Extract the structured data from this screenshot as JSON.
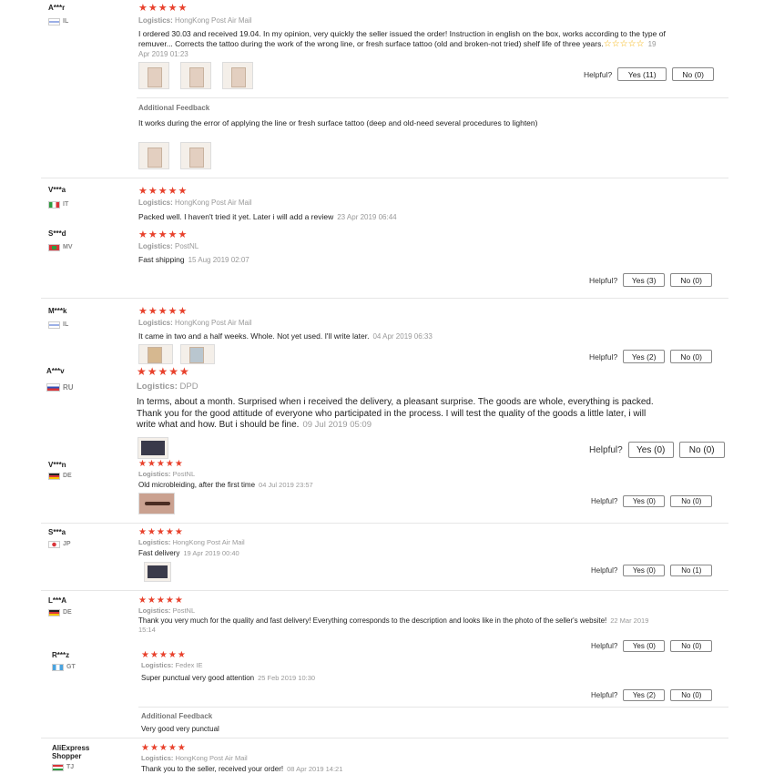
{
  "colors": {
    "star": "#e8412c",
    "accent_star": "#f5b000",
    "muted": "#999999"
  },
  "helpful_label": "Helpful?",
  "additional_feedback_label": "Additional Feedback",
  "logistics_label": "Logistics:",
  "reviews": [
    {
      "user": "A***r",
      "country": "IL",
      "rating": 5,
      "logistics": "HongKong Post Air Mail",
      "text": "I ordered 30.03 and received 19.04. In my opinion, very quickly the seller issued the order! Instruction in english on the box, works according to the type of remuver... Corrects the tattoo during the work of the wrong line, or fresh surface tattoo (old and broken-not tried) shelf life of three years.",
      "date": "19 Apr 2019 01:23",
      "yes": "Yes (11)",
      "no": "No (0)",
      "additional_text": "It works during the error of applying the line or fresh surface tattoo (deep and old-need several procedures to lighten)"
    },
    {
      "user": "V***a",
      "country": "IT",
      "rating": 5,
      "logistics": "HongKong Post Air Mail",
      "text": "Packed well. I haven't tried it yet. Later i will add a review",
      "date": "23 Apr 2019 06:44"
    },
    {
      "user": "S***d",
      "country": "MV",
      "rating": 5,
      "logistics": "PostNL",
      "text": "Fast shipping",
      "date": "15 Aug 2019 02:07",
      "yes": "Yes (3)",
      "no": "No (0)"
    },
    {
      "user": "M***k",
      "country": "IL",
      "rating": 5,
      "logistics": "HongKong Post Air Mail",
      "text": "It came in two and a half weeks. Whole. Not yet used. I'll write later.",
      "date": "04 Apr 2019 06:33",
      "yes": "Yes (2)",
      "no": "No (0)"
    },
    {
      "user": "A***v",
      "country": "RU",
      "rating": 5,
      "logistics": "DPD",
      "text": "In terms, about a month. Surprised when i received the delivery, a pleasant surprise. The goods are whole, everything is packed. Thank you for the good attitude of everyone who participated in the process. I will test the quality of the goods a little later, i will write what and how. But i should be fine.",
      "date": "09 Jul 2019 05:09",
      "yes": "Yes (0)",
      "no": "No (0)"
    },
    {
      "user": "V***n",
      "country": "DE",
      "rating": 5,
      "logistics": "PostNL",
      "text": "Old microbleiding, after the first time",
      "date": "04 Jul 2019 23:57",
      "yes": "Yes (0)",
      "no": "No (0)"
    },
    {
      "user": "S***a",
      "country": "JP",
      "rating": 5,
      "logistics": "HongKong Post Air Mail",
      "text": "Fast delivery",
      "date": "19 Apr 2019 00:40",
      "yes": "Yes (0)",
      "no": "No (1)"
    },
    {
      "user": "L***A",
      "country": "DE",
      "rating": 5,
      "logistics": "PostNL",
      "text": "Thank you very much for the quality and fast delivery! Everything corresponds to the description and looks like in the photo of the seller's website!",
      "date": "22 Mar 2019 15:14",
      "yes": "Yes (0)",
      "no": "No (0)"
    },
    {
      "user": "R***z",
      "country": "GT",
      "rating": 5,
      "logistics": "Fedex IE",
      "text": "Super punctual very good attention",
      "date": "25 Feb 2019 10:30",
      "yes": "Yes (2)",
      "no": "No (0)",
      "additional_text": "Very good very punctual"
    },
    {
      "user": "AliExpress Shopper",
      "country": "TJ",
      "rating": 5,
      "logistics": "HongKong Post Air Mail",
      "text": "Thank you to the seller, received your order!",
      "date": "08 Apr 2019 14:21"
    }
  ]
}
